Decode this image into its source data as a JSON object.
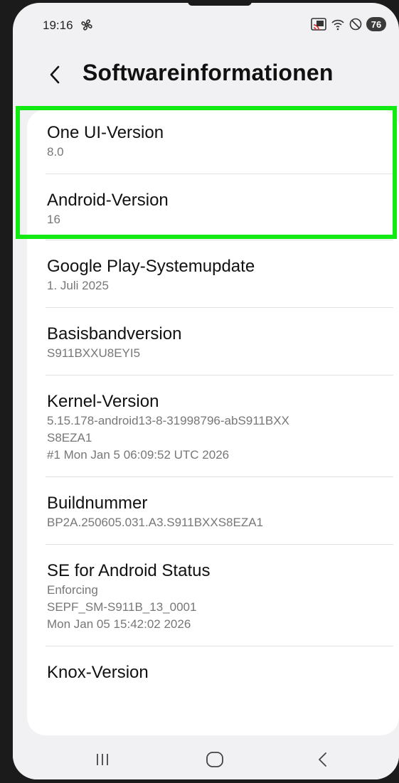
{
  "status_bar": {
    "time": "19:16",
    "battery": "76"
  },
  "header": {
    "title": "Softwareinformationen"
  },
  "items": [
    {
      "label": "One UI-Version",
      "values": [
        "8.0"
      ]
    },
    {
      "label": "Android-Version",
      "values": [
        "16"
      ]
    },
    {
      "label": "Google Play-Systemupdate",
      "values": [
        "1. Juli 2025"
      ]
    },
    {
      "label": "Basisbandversion",
      "values": [
        "S911BXXU8EYI5"
      ]
    },
    {
      "label": "Kernel-Version",
      "values": [
        "5.15.178-android13-8-31998796-abS911BXX",
        "S8EZA1",
        "#1 Mon Jan 5 06:09:52 UTC 2026"
      ]
    },
    {
      "label": "Buildnummer",
      "values": [
        "BP2A.250605.031.A3.S911BXXS8EZA1"
      ]
    },
    {
      "label": "SE for Android Status",
      "values": [
        "Enforcing",
        "SEPF_SM-S911B_13_0001",
        "Mon Jan 05 15:42:02 2026"
      ]
    },
    {
      "label": "Knox-Version",
      "values": []
    }
  ],
  "colors": {
    "highlight": "#13ea13",
    "background": "#f1f1f3",
    "card": "#ffffff"
  },
  "icons": {
    "status_left": "fan-icon",
    "status_right": [
      "cast-icon",
      "wifi-icon",
      "do-not-disturb-icon",
      "battery-icon"
    ],
    "nav": [
      "recents-icon",
      "home-icon",
      "back-icon"
    ]
  }
}
